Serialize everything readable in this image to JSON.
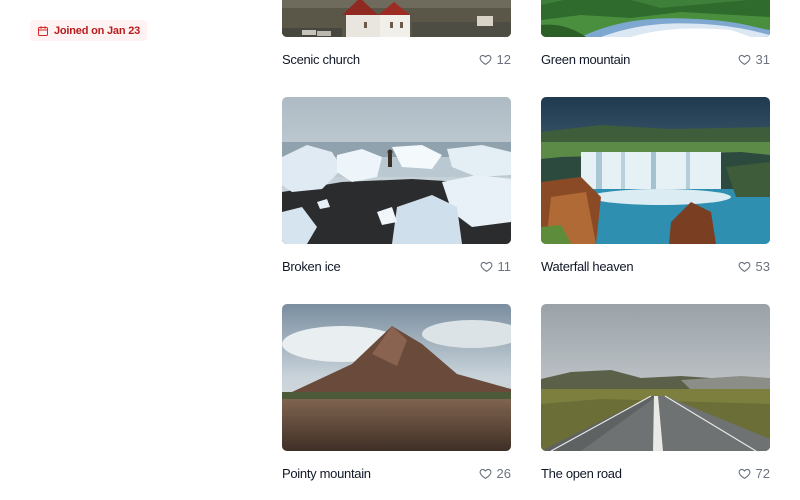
{
  "profile": {
    "joined_label": "Joined on Jan 23",
    "badge_icon": "calendar-icon",
    "badge_color": "#b91c1c",
    "badge_bg": "#fef2f2"
  },
  "gallery": {
    "items": [
      {
        "title": "Scenic church",
        "likes": "12",
        "like_icon": "heart-icon",
        "image": "church-photo"
      },
      {
        "title": "Green mountain",
        "likes": "31",
        "like_icon": "heart-icon",
        "image": "river-photo"
      },
      {
        "title": "Broken ice",
        "likes": "11",
        "like_icon": "heart-icon",
        "image": "ice-beach-photo"
      },
      {
        "title": "Waterfall heaven",
        "likes": "53",
        "like_icon": "heart-icon",
        "image": "waterfall-photo"
      },
      {
        "title": "Pointy mountain",
        "likes": "26",
        "like_icon": "heart-icon",
        "image": "mountain-photo"
      },
      {
        "title": "The open road",
        "likes": "72",
        "like_icon": "heart-icon",
        "image": "road-photo"
      }
    ]
  }
}
